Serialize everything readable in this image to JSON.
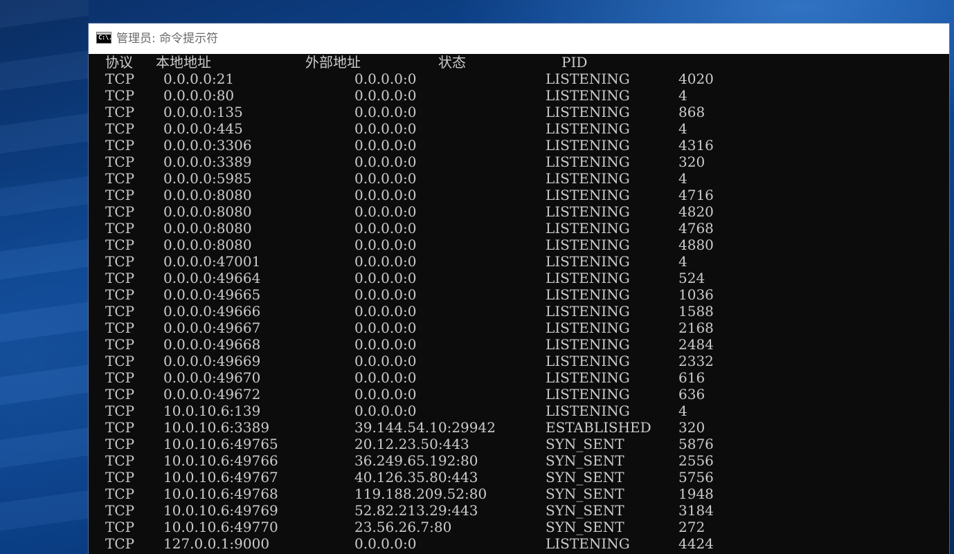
{
  "window": {
    "title": "管理员: 命令提示符",
    "icon": "cmd-icon",
    "icon_text": "C:\\."
  },
  "console": {
    "headers": {
      "proto": "协议",
      "local": "本地地址",
      "foreign": "外部地址",
      "state": "状态",
      "pid": "PID"
    },
    "rows": [
      {
        "proto": "TCP",
        "local": "0.0.0.0:21",
        "foreign": "0.0.0.0:0",
        "state": "LISTENING",
        "pid": "4020"
      },
      {
        "proto": "TCP",
        "local": "0.0.0.0:80",
        "foreign": "0.0.0.0:0",
        "state": "LISTENING",
        "pid": "4"
      },
      {
        "proto": "TCP",
        "local": "0.0.0.0:135",
        "foreign": "0.0.0.0:0",
        "state": "LISTENING",
        "pid": "868"
      },
      {
        "proto": "TCP",
        "local": "0.0.0.0:445",
        "foreign": "0.0.0.0:0",
        "state": "LISTENING",
        "pid": "4"
      },
      {
        "proto": "TCP",
        "local": "0.0.0.0:3306",
        "foreign": "0.0.0.0:0",
        "state": "LISTENING",
        "pid": "4316"
      },
      {
        "proto": "TCP",
        "local": "0.0.0.0:3389",
        "foreign": "0.0.0.0:0",
        "state": "LISTENING",
        "pid": "320"
      },
      {
        "proto": "TCP",
        "local": "0.0.0.0:5985",
        "foreign": "0.0.0.0:0",
        "state": "LISTENING",
        "pid": "4"
      },
      {
        "proto": "TCP",
        "local": "0.0.0.0:8080",
        "foreign": "0.0.0.0:0",
        "state": "LISTENING",
        "pid": "4716"
      },
      {
        "proto": "TCP",
        "local": "0.0.0.0:8080",
        "foreign": "0.0.0.0:0",
        "state": "LISTENING",
        "pid": "4820"
      },
      {
        "proto": "TCP",
        "local": "0.0.0.0:8080",
        "foreign": "0.0.0.0:0",
        "state": "LISTENING",
        "pid": "4768"
      },
      {
        "proto": "TCP",
        "local": "0.0.0.0:8080",
        "foreign": "0.0.0.0:0",
        "state": "LISTENING",
        "pid": "4880"
      },
      {
        "proto": "TCP",
        "local": "0.0.0.0:47001",
        "foreign": "0.0.0.0:0",
        "state": "LISTENING",
        "pid": "4"
      },
      {
        "proto": "TCP",
        "local": "0.0.0.0:49664",
        "foreign": "0.0.0.0:0",
        "state": "LISTENING",
        "pid": "524"
      },
      {
        "proto": "TCP",
        "local": "0.0.0.0:49665",
        "foreign": "0.0.0.0:0",
        "state": "LISTENING",
        "pid": "1036"
      },
      {
        "proto": "TCP",
        "local": "0.0.0.0:49666",
        "foreign": "0.0.0.0:0",
        "state": "LISTENING",
        "pid": "1588"
      },
      {
        "proto": "TCP",
        "local": "0.0.0.0:49667",
        "foreign": "0.0.0.0:0",
        "state": "LISTENING",
        "pid": "2168"
      },
      {
        "proto": "TCP",
        "local": "0.0.0.0:49668",
        "foreign": "0.0.0.0:0",
        "state": "LISTENING",
        "pid": "2484"
      },
      {
        "proto": "TCP",
        "local": "0.0.0.0:49669",
        "foreign": "0.0.0.0:0",
        "state": "LISTENING",
        "pid": "2332"
      },
      {
        "proto": "TCP",
        "local": "0.0.0.0:49670",
        "foreign": "0.0.0.0:0",
        "state": "LISTENING",
        "pid": "616"
      },
      {
        "proto": "TCP",
        "local": "0.0.0.0:49672",
        "foreign": "0.0.0.0:0",
        "state": "LISTENING",
        "pid": "636"
      },
      {
        "proto": "TCP",
        "local": "10.0.10.6:139",
        "foreign": "0.0.0.0:0",
        "state": "LISTENING",
        "pid": "4"
      },
      {
        "proto": "TCP",
        "local": "10.0.10.6:3389",
        "foreign": "39.144.54.10:29942",
        "state": "ESTABLISHED",
        "pid": "320"
      },
      {
        "proto": "TCP",
        "local": "10.0.10.6:49765",
        "foreign": "20.12.23.50:443",
        "state": "SYN_SENT",
        "pid": "5876"
      },
      {
        "proto": "TCP",
        "local": "10.0.10.6:49766",
        "foreign": "36.249.65.192:80",
        "state": "SYN_SENT",
        "pid": "2556"
      },
      {
        "proto": "TCP",
        "local": "10.0.10.6:49767",
        "foreign": "40.126.35.80:443",
        "state": "SYN_SENT",
        "pid": "5756"
      },
      {
        "proto": "TCP",
        "local": "10.0.10.6:49768",
        "foreign": "119.188.209.52:80",
        "state": "SYN_SENT",
        "pid": "1948"
      },
      {
        "proto": "TCP",
        "local": "10.0.10.6:49769",
        "foreign": "52.82.213.29:443",
        "state": "SYN_SENT",
        "pid": "3184"
      },
      {
        "proto": "TCP",
        "local": "10.0.10.6:49770",
        "foreign": "23.56.26.7:80",
        "state": "SYN_SENT",
        "pid": "272"
      },
      {
        "proto": "TCP",
        "local": "127.0.0.1:9000",
        "foreign": "0.0.0.0:0",
        "state": "LISTENING",
        "pid": "4424"
      }
    ]
  },
  "colors": {
    "console_bg": "#0c0c0c",
    "console_fg": "#cccccc",
    "titlebar_bg": "#ffffff",
    "title_fg": "#6a6a6a"
  }
}
